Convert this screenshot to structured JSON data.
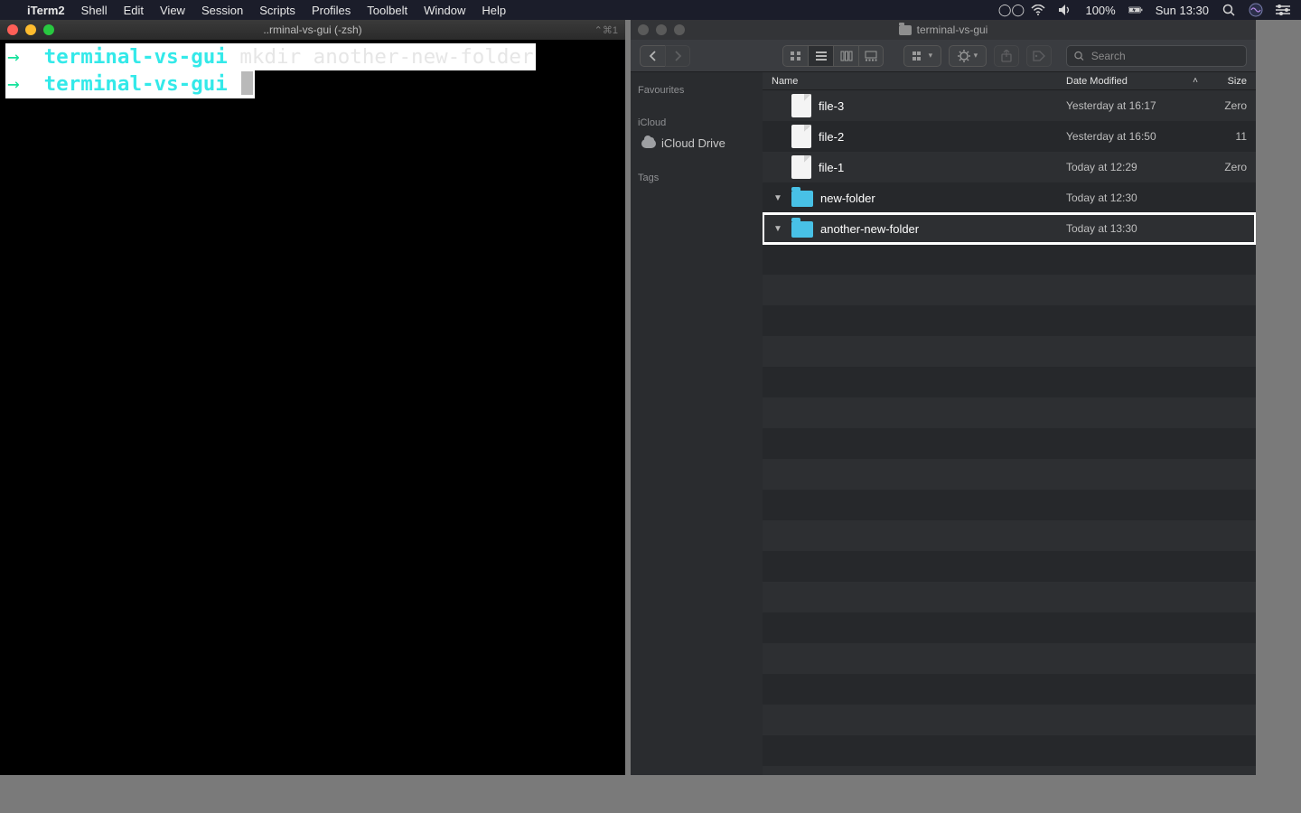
{
  "menubar": {
    "app": "iTerm2",
    "items": [
      "Shell",
      "Edit",
      "View",
      "Session",
      "Scripts",
      "Profiles",
      "Toolbelt",
      "Window",
      "Help"
    ],
    "status": {
      "battery": "100%",
      "clock": "Sun 13:30"
    }
  },
  "terminal": {
    "title": "..rminal-vs-gui (-zsh)",
    "right_badge": "⌃⌘1",
    "lines": [
      {
        "arrow": "→",
        "dir": "terminal-vs-gui",
        "cmd": "mkdir another-new-folder",
        "highlighted": true,
        "cursor": false
      },
      {
        "arrow": "→",
        "dir": "terminal-vs-gui",
        "cmd": "",
        "highlighted": true,
        "cursor": true
      }
    ]
  },
  "finder": {
    "title": "terminal-vs-gui",
    "search_placeholder": "Search",
    "sidebar": {
      "sections": [
        {
          "head": "Favourites",
          "items": []
        },
        {
          "head": "iCloud",
          "items": [
            {
              "label": "iCloud Drive",
              "icon": "cloud"
            }
          ]
        },
        {
          "head": "Tags",
          "items": []
        }
      ]
    },
    "columns": {
      "name": "Name",
      "date": "Date Modified",
      "size": "Size"
    },
    "rows": [
      {
        "kind": "file",
        "name": "file-3",
        "date": "Yesterday at 16:17",
        "size": "Zero",
        "highlighted": false
      },
      {
        "kind": "file",
        "name": "file-2",
        "date": "Yesterday at 16:50",
        "size": "11",
        "highlighted": false
      },
      {
        "kind": "file",
        "name": "file-1",
        "date": "Today at 12:29",
        "size": "Zero",
        "highlighted": false
      },
      {
        "kind": "folder",
        "name": "new-folder",
        "date": "Today at 12:30",
        "size": "",
        "highlighted": false
      },
      {
        "kind": "folder",
        "name": "another-new-folder",
        "date": "Today at 13:30",
        "size": "",
        "highlighted": true
      }
    ]
  }
}
